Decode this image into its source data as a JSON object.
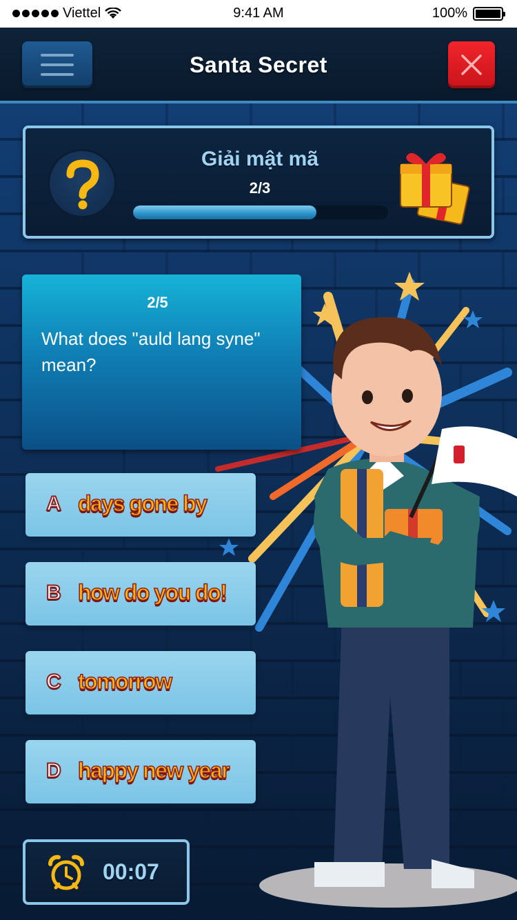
{
  "status_bar": {
    "carrier": "Viettel",
    "time": "9:41 AM",
    "battery": "100%"
  },
  "header": {
    "title": "Santa Secret",
    "menu_icon": "hamburger-menu-icon",
    "close_icon": "close-icon"
  },
  "progress_panel": {
    "title": "Giải mật mã",
    "count": "2/3",
    "progress_fraction": 0.72,
    "left_icon": "question-mark-icon",
    "right_icon": "gift-box-icon"
  },
  "question": {
    "number": "2/5",
    "text": "What does \"auld lang syne\" mean?"
  },
  "answers": [
    {
      "letter": "A",
      "text": "days gone by"
    },
    {
      "letter": "B",
      "text": "how do you do!"
    },
    {
      "letter": "C",
      "text": "tomorrow"
    },
    {
      "letter": "D",
      "text": "happy new year"
    }
  ],
  "timer": {
    "value": "00:07",
    "icon": "alarm-clock-icon"
  },
  "colors": {
    "accent_blue": "#8cc6e8",
    "answer_text": "#ffb10f",
    "close_red": "#e81c22"
  }
}
